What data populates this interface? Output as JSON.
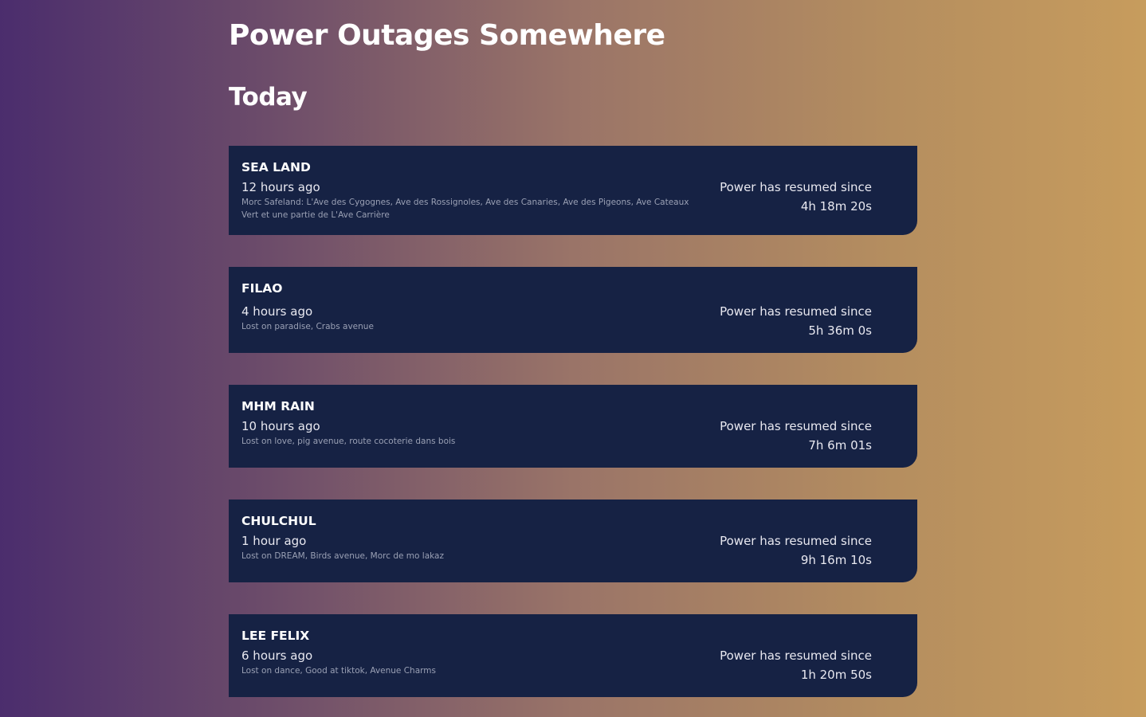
{
  "header": {
    "title": "Power Outages Somewhere",
    "section": "Today"
  },
  "colors": {
    "card_background": "#162244",
    "gradient_start": "#4b2d6d",
    "gradient_end": "#c79c5d"
  },
  "outages": [
    {
      "area": "SEA LAND",
      "time_ago": "12 hours ago",
      "streets": "Morc Safeland: L'Ave des Cygognes, Ave des Rossignoles, Ave des Canaries, Ave des Pigeons, Ave Cateaux Vert et une partie de L'Ave Carrière",
      "status_label": "Power has resumed since",
      "duration": "4h 18m 20s"
    },
    {
      "area": "FILAO",
      "time_ago": "4 hours ago",
      "streets": "Lost on paradise, Crabs avenue",
      "status_label": "Power has resumed since",
      "duration": "5h 36m 0s"
    },
    {
      "area": "MHM RAIN",
      "time_ago": "10 hours ago",
      "streets": "Lost on love, pig avenue, route cocoterie dans bois",
      "status_label": "Power has resumed since",
      "duration": "7h 6m 01s"
    },
    {
      "area": "CHULCHUL",
      "time_ago": "1 hour ago",
      "streets": "Lost on DREAM, Birds avenue, Morc de mo lakaz",
      "status_label": "Power has resumed since",
      "duration": "9h 16m 10s"
    },
    {
      "area": "LEE FELIX",
      "time_ago": "6 hours ago",
      "streets": "Lost on dance, Good at tiktok, Avenue Charms",
      "status_label": "Power has resumed since",
      "duration": "1h 20m 50s"
    }
  ]
}
